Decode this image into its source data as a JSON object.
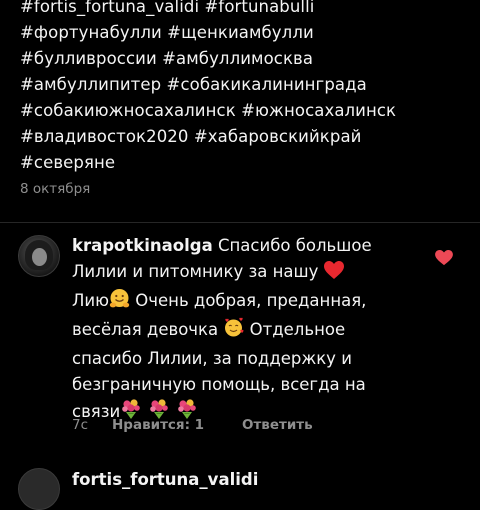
{
  "post": {
    "caption_lines": [
      "#fortis_fortuna_validi #fortunabulli",
      "#фортунабулли #щенкиамбулли",
      "#булливроссии #амбуллимосква",
      "#амбуллипитер #собакикалининграда",
      "#собакиюжносахалинск #южносахалинск",
      "#владивосток2020 #хабаровскийкрай",
      "#северяне"
    ],
    "date": "8 октября"
  },
  "comment": {
    "username": "krapotkinaolga",
    "line1_rest": "Спасибо большое",
    "line2": "Лилии и питомнику за нашу ",
    "line3_start": "Лию",
    "line3_rest": " Очень добрая, преданная,",
    "line4_start": "весёлая девочка ",
    "line4_rest": " Отдельное",
    "line5": "спасибо Лилии, за поддержку и",
    "line6": "безграничную помощь, всегда на",
    "line7_start": "связи",
    "time": "7с",
    "likes": "Нравится: 1",
    "reply_label": "Ответить",
    "icons": {
      "heart_emoji": "red-heart-icon",
      "hug_emoji": "hugging-face-icon",
      "smiling_hearts_emoji": "smiling-face-with-hearts-icon",
      "bouquet_emoji": "bouquet-icon",
      "like": "heart-icon"
    },
    "like_color": "#ed4956"
  },
  "next_comment": {
    "username": "fortis_fortuna_validi"
  }
}
